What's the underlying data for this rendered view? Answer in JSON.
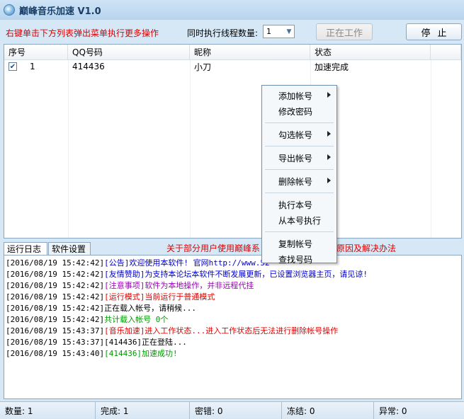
{
  "window": {
    "title": "巅峰音乐加速 V1.0"
  },
  "toolbar": {
    "hint": "右键单击下方列表弹出菜单执行更多操作",
    "thread_label": "同时执行线程数量:",
    "thread_value": "1",
    "working_label": "正在工作",
    "stop_label": "停止"
  },
  "table": {
    "columns": [
      "序号",
      "QQ号码",
      "昵称",
      "状态"
    ],
    "rows": [
      {
        "checked": true,
        "index": "1",
        "qq": "414436",
        "nickname": "小刀",
        "status": "加速完成"
      }
    ]
  },
  "tabs": {
    "log": "运行日志",
    "settings": "软件设置"
  },
  "notice": "关于部分用户使用巅峰系",
  "notice_tail": "原因及解决办法",
  "log": [
    {
      "time": "[2016/08/19 15:42:42]",
      "text": "[公告]欢迎使用本软件! 官网http://www.52",
      "color": "#0000cc"
    },
    {
      "time": "[2016/08/19 15:42:42]",
      "text": "[友情赞助]为支持本论坛本软件不断发展更新，已设置浏览器主页，请见谅!",
      "color": "#0000cc"
    },
    {
      "time": "[2016/08/19 15:42:42]",
      "text": "[注意事项]软件为本地操作，并非远程代挂",
      "color": "#9b00b4"
    },
    {
      "time": "[2016/08/19 15:42:42]",
      "text": "[运行模式]当前运行于普通模式",
      "color": "#e00000"
    },
    {
      "time": "[2016/08/19 15:42:42]",
      "text": "正在载入帐号，请稍候...",
      "color": "#000000"
    },
    {
      "time": "[2016/08/19 15:42:42]",
      "text": "共计载入帐号 0个",
      "color": "#009900"
    },
    {
      "time": "[2016/08/19 15:43:37]",
      "text": "[音乐加速]进入工作状态...进入工作状态后无法进行删除帐号操作",
      "color": "#e00000"
    },
    {
      "time": "[2016/08/19 15:43:37]",
      "text": "[414436]正在登陆...",
      "color": "#000000"
    },
    {
      "time": "[2016/08/19 15:43:40]",
      "text": "[414436]加速成功!",
      "color": "#009900"
    }
  ],
  "status": {
    "count": "数量: 1",
    "done": "完成: 1",
    "password_error": "密错: 0",
    "frozen": "冻结: 0",
    "error": "异常: 0"
  },
  "context_menu": {
    "groups": [
      [
        {
          "label": "添加帐号",
          "submenu": true
        },
        {
          "label": "修改密码",
          "submenu": false
        }
      ],
      [
        {
          "label": "勾选帐号",
          "submenu": true
        }
      ],
      [
        {
          "label": "导出帐号",
          "submenu": true
        }
      ],
      [
        {
          "label": "删除帐号",
          "submenu": true
        }
      ],
      [
        {
          "label": "执行本号",
          "submenu": false
        },
        {
          "label": "从本号执行",
          "submenu": false
        }
      ],
      [
        {
          "label": "复制帐号",
          "submenu": false
        },
        {
          "label": "查找号码",
          "submenu": false
        }
      ]
    ]
  }
}
